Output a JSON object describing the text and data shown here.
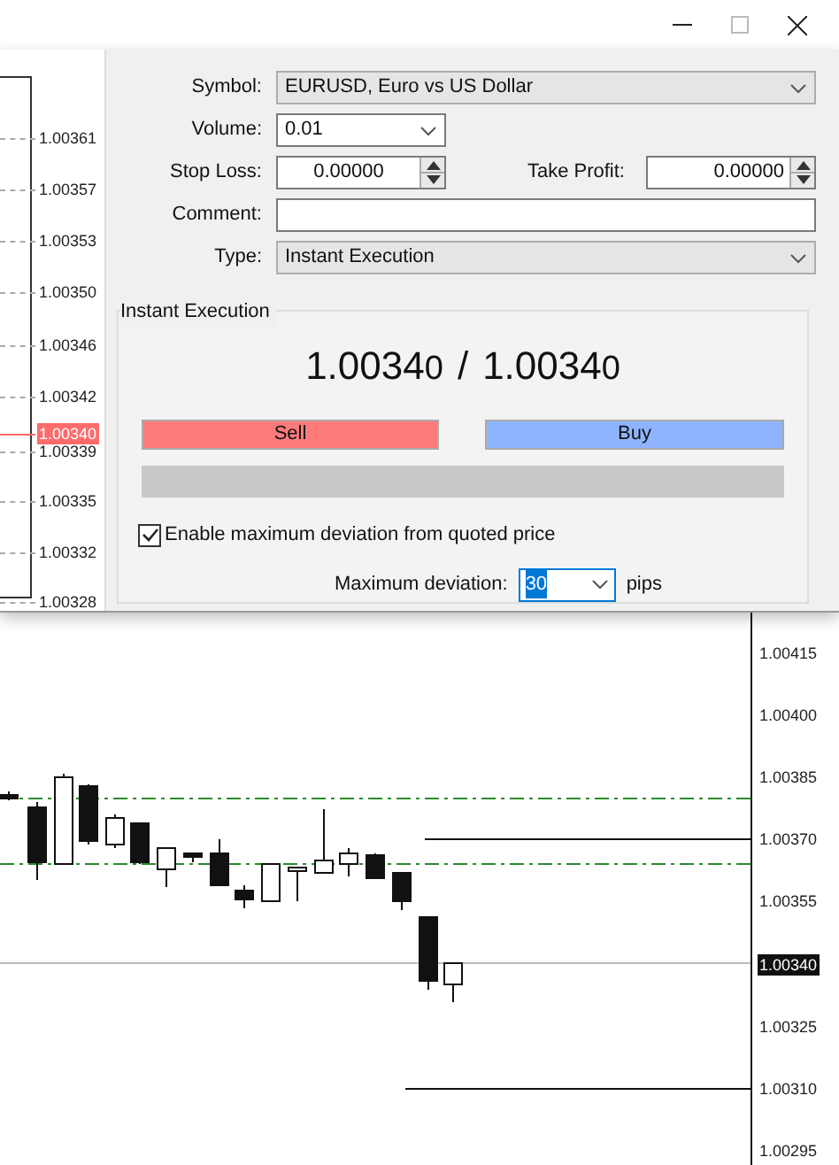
{
  "tick_chart": {
    "price_labels": [
      {
        "text": "1.00361",
        "current": false
      },
      {
        "text": "1.00357",
        "current": false
      },
      {
        "text": "1.00353",
        "current": false
      },
      {
        "text": "1.00350",
        "current": false
      },
      {
        "text": "1.00346",
        "current": false
      },
      {
        "text": "1.00342",
        "current": false
      },
      {
        "text": "1.00340",
        "current": true
      },
      {
        "text": "1.00339",
        "current": false
      },
      {
        "text": "1.00335",
        "current": false
      },
      {
        "text": "1.00332",
        "current": false
      },
      {
        "text": "1.00328",
        "current": false
      }
    ]
  },
  "order_form": {
    "symbol": {
      "label": "Symbol:",
      "value": "EURUSD, Euro vs US Dollar"
    },
    "volume": {
      "label": "Volume:",
      "value": "0.01"
    },
    "stop_loss": {
      "label": "Stop Loss:",
      "value": "0.00000"
    },
    "take_profit": {
      "label": "Take Profit:",
      "value": "0.00000"
    },
    "comment": {
      "label": "Comment:"
    },
    "type": {
      "label": "Type:",
      "value": "Instant Execution"
    }
  },
  "execution": {
    "title": "Instant Execution",
    "bid": {
      "main": "1.0034",
      "last": "0"
    },
    "separator": "/",
    "ask": {
      "main": "1.0034",
      "last": "0"
    },
    "sell": "Sell",
    "buy": "Buy",
    "deviation_enabled": {
      "label": "Enable maximum deviation from quoted price",
      "checked": true
    },
    "max_deviation": {
      "label": "Maximum deviation:",
      "value": "30",
      "text_selected": true,
      "unit": "pips"
    }
  },
  "main_chart": {
    "price_axis": [
      {
        "text": "1.00415",
        "current": false
      },
      {
        "text": "1.00400",
        "current": false
      },
      {
        "text": "1.00385",
        "current": false
      },
      {
        "text": "1.00370",
        "current": false
      },
      {
        "text": "1.00355",
        "current": false
      },
      {
        "text": "1.00340",
        "current": true
      },
      {
        "text": "1.00325",
        "current": false
      },
      {
        "text": "1.00310",
        "current": false
      },
      {
        "text": "1.00295",
        "current": false
      }
    ]
  }
}
